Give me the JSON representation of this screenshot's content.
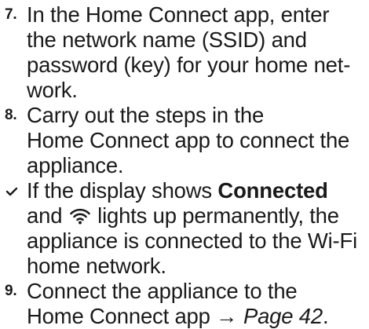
{
  "steps": [
    {
      "marker": "7.",
      "text": "In the Home Connect app, enter the network name (SSID) and password (key) for your home network."
    },
    {
      "marker": "8.",
      "text": "Carry out the steps in the Home Connect app to connect the appliance."
    }
  ],
  "result": {
    "marker_icon": "checkmark-icon",
    "text_before_bold": "If the display shows ",
    "bold_text": "Connected",
    "text_before_icon": " and ",
    "icon": "wifi-icon",
    "text_after_icon": " lights up permanently, the appliance is connected to the Wi-Fi home network."
  },
  "step9": {
    "marker": "9.",
    "text": "Connect the appliance to the Home Connect app → ",
    "page_ref": "Page 42",
    "trailing": "."
  }
}
